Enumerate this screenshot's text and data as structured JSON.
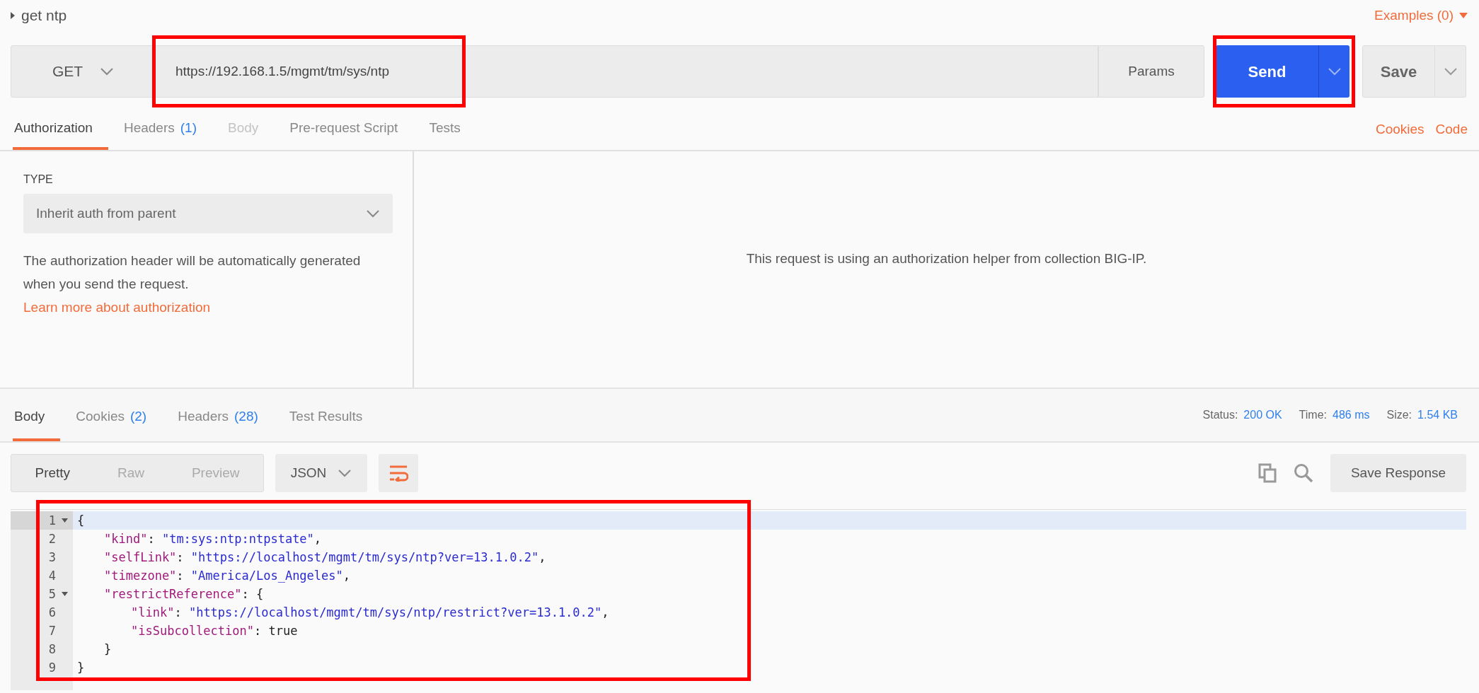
{
  "request": {
    "name": "get ntp",
    "examples": "Examples (0)",
    "method": "GET",
    "url": "https://192.168.1.5/mgmt/tm/sys/ntp",
    "url_highlighted": true,
    "params": "Params",
    "send": "Send",
    "send_highlighted": true,
    "save": "Save"
  },
  "request_tabs": [
    {
      "label": "Authorization",
      "selected": true,
      "disabled": false
    },
    {
      "label": "Headers",
      "count": "(1)",
      "selected": false,
      "disabled": false
    },
    {
      "label": "Body",
      "selected": false,
      "disabled": true
    },
    {
      "label": "Pre-request Script",
      "selected": false,
      "disabled": false
    },
    {
      "label": "Tests",
      "selected": false,
      "disabled": false
    }
  ],
  "request_links": [
    "Cookies",
    "Code"
  ],
  "auth": {
    "type_label": "TYPE",
    "type_value": "Inherit auth from parent",
    "description": "The authorization header will be automatically generated when you send the request.",
    "learn_link": "Learn more about authorization",
    "helper_text": "This request is using an authorization helper from collection",
    "helper_link": "BIG-IP",
    "helper_end": "."
  },
  "response_tabs": [
    {
      "label": "Body",
      "selected": true
    },
    {
      "label": "Cookies",
      "count": "(2)",
      "selected": false
    },
    {
      "label": "Headers",
      "count": "(28)",
      "selected": false
    },
    {
      "label": "Test Results",
      "selected": false
    }
  ],
  "response_stats": [
    {
      "label": "Status:",
      "value": "200 OK"
    },
    {
      "label": "Time:",
      "value": "486 ms"
    },
    {
      "label": "Size:",
      "value": "1.54 KB"
    }
  ],
  "view_modes": [
    {
      "label": "Pretty",
      "selected": true
    },
    {
      "label": "Raw",
      "selected": false
    },
    {
      "label": "Preview",
      "selected": false
    }
  ],
  "format": "JSON",
  "save_response": "Save Response",
  "body_highlighted": true,
  "code_lines": [
    {
      "number": "1",
      "foldable": true,
      "active": true,
      "tokens": [
        {
          "kind": "punct",
          "text": "{"
        }
      ]
    },
    {
      "number": "2",
      "foldable": false,
      "active": false,
      "tokens": [
        {
          "kind": "key",
          "text": "\"kind\""
        },
        {
          "kind": "punct",
          "text": ": "
        },
        {
          "kind": "string",
          "text": "\"tm:sys:ntp:ntpstate\""
        },
        {
          "kind": "punct",
          "text": ","
        }
      ]
    },
    {
      "number": "3",
      "foldable": false,
      "active": false,
      "tokens": [
        {
          "kind": "key",
          "text": "\"selfLink\""
        },
        {
          "kind": "punct",
          "text": ": "
        },
        {
          "kind": "string",
          "text": "\"https://localhost/mgmt/tm/sys/ntp?ver=13.1.0.2\""
        },
        {
          "kind": "punct",
          "text": ","
        }
      ]
    },
    {
      "number": "4",
      "foldable": false,
      "active": false,
      "tokens": [
        {
          "kind": "key",
          "text": "\"timezone\""
        },
        {
          "kind": "punct",
          "text": ": "
        },
        {
          "kind": "string",
          "text": "\"America/Los_Angeles\""
        },
        {
          "kind": "punct",
          "text": ","
        }
      ]
    },
    {
      "number": "5",
      "foldable": true,
      "active": false,
      "tokens": [
        {
          "kind": "key",
          "text": "\"restrictReference\""
        },
        {
          "kind": "punct",
          "text": ": {"
        }
      ]
    },
    {
      "number": "6",
      "foldable": false,
      "active": false,
      "tokens": [
        {
          "kind": "key",
          "text": "\"link\""
        },
        {
          "kind": "punct",
          "text": ": "
        },
        {
          "kind": "string",
          "text": "\"https://localhost/mgmt/tm/sys/ntp/restrict?ver=13.1.0.2\""
        },
        {
          "kind": "punct",
          "text": ","
        }
      ]
    },
    {
      "number": "7",
      "foldable": false,
      "active": false,
      "tokens": [
        {
          "kind": "key",
          "text": "\"isSubcollection\""
        },
        {
          "kind": "punct",
          "text": ": "
        },
        {
          "kind": "literal",
          "text": "true"
        }
      ]
    },
    {
      "number": "8",
      "foldable": false,
      "active": false,
      "tokens": [
        {
          "kind": "punct",
          "text": "}"
        }
      ]
    },
    {
      "number": "9",
      "foldable": false,
      "active": false,
      "tokens": [
        {
          "kind": "punct",
          "text": "}"
        }
      ]
    }
  ]
}
